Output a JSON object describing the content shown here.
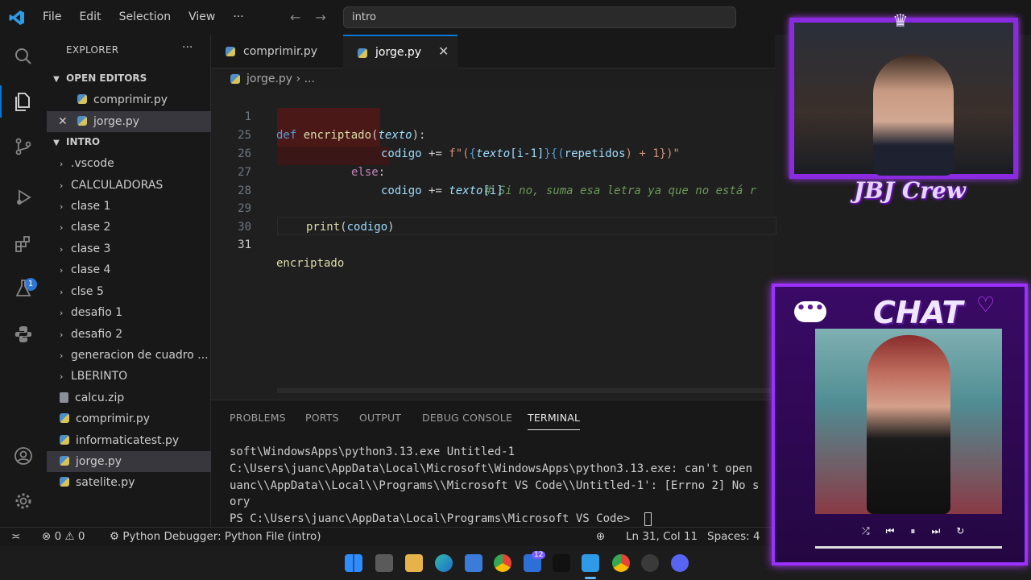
{
  "menu": {
    "file": "File",
    "edit": "Edit",
    "selection": "Selection",
    "view": "View",
    "more": "···"
  },
  "command_center": {
    "text": "intro"
  },
  "activity": {
    "extensions_badge": "1"
  },
  "sidebar": {
    "title": "EXPLORER",
    "more": "···",
    "open_editors_title": "OPEN EDITORS",
    "open_editors": [
      {
        "name": "comprimir.py"
      },
      {
        "name": "jorge.py"
      }
    ],
    "folder_title": "INTRO",
    "tree": [
      {
        "name": ".vscode",
        "type": "folder"
      },
      {
        "name": "CALCULADORAS",
        "type": "folder"
      },
      {
        "name": "clase 1",
        "type": "folder"
      },
      {
        "name": "clase 2",
        "type": "folder"
      },
      {
        "name": "clase 3",
        "type": "folder"
      },
      {
        "name": "clase 4",
        "type": "folder"
      },
      {
        "name": "clse 5",
        "type": "folder"
      },
      {
        "name": "desafio 1",
        "type": "folder"
      },
      {
        "name": "desafio 2",
        "type": "folder"
      },
      {
        "name": "generacion de cuadro ...",
        "type": "folder"
      },
      {
        "name": "LBERINTO",
        "type": "folder"
      },
      {
        "name": "calcu.zip",
        "type": "zip"
      },
      {
        "name": "comprimir.py",
        "type": "py"
      },
      {
        "name": "informaticatest.py",
        "type": "py"
      },
      {
        "name": "jorge.py",
        "type": "py"
      },
      {
        "name": "satelite.py",
        "type": "py"
      }
    ]
  },
  "tabs": [
    {
      "label": "comprimir.py"
    },
    {
      "label": "jorge.py"
    }
  ],
  "breadcrumb": {
    "file": "jorge.py",
    "rest": "› ..."
  },
  "editor": {
    "line_numbers": [
      "1",
      "25",
      "26",
      "27",
      "28",
      "29",
      "30",
      "31"
    ],
    "lines": {
      "l1": {
        "kw": "def",
        "fn": "encriptado",
        "open": "(",
        "param": "texto",
        "close": "):"
      },
      "l25": {
        "var": "codigo",
        "op": " += ",
        "pre": "f\"(",
        "brace1": "{",
        "p1": "texto",
        "idx": "[i-1]",
        "brace2": "}{(",
        "p2": "repetidos",
        "rest": ") + 1})\""
      },
      "l26": {
        "kw": "else",
        "colon": ":",
        "comment": "# Si no, suma esa letra ya que no está r"
      },
      "l27": {
        "var": "codigo",
        "op": " += ",
        "param": "texto",
        "idx": "[i]"
      },
      "l29": {
        "fn": "print",
        "open": "(",
        "var": "codigo",
        "close": ")"
      },
      "l31": {
        "fn": "encriptado"
      }
    }
  },
  "panel": {
    "tabs": [
      "PROBLEMS",
      "PORTS",
      "OUTPUT",
      "DEBUG CONSOLE",
      "TERMINAL"
    ],
    "terminal": [
      "soft\\WindowsApps\\python3.13.exe Untitled-1",
      "C:\\Users\\juanc\\AppData\\Local\\Microsoft\\WindowsApps\\python3.13.exe: can't open",
      "uanc\\\\AppData\\\\Local\\\\Programs\\\\Microsoft VS Code\\\\Untitled-1': [Errno 2] No s",
      "ory",
      "PS C:\\Users\\juanc\\AppData\\Local\\Programs\\Microsoft VS Code> "
    ]
  },
  "statusbar": {
    "errors": "0",
    "warnings": "0",
    "debugger": "Python Debugger: Python File (intro)",
    "position": "Ln 31, Col 11",
    "spaces": "Spaces: 4"
  },
  "taskbar": {
    "badge": "12"
  },
  "overlays": {
    "crew_logo": "JBJ Crew",
    "chat_title": "CHAT",
    "chat_bubble": "•••"
  },
  "colors": {
    "accent": "#0078d4",
    "editor_bg": "#1f1f1f",
    "chrome_bg": "#181818",
    "overlay_purple": "#9b30ff"
  }
}
